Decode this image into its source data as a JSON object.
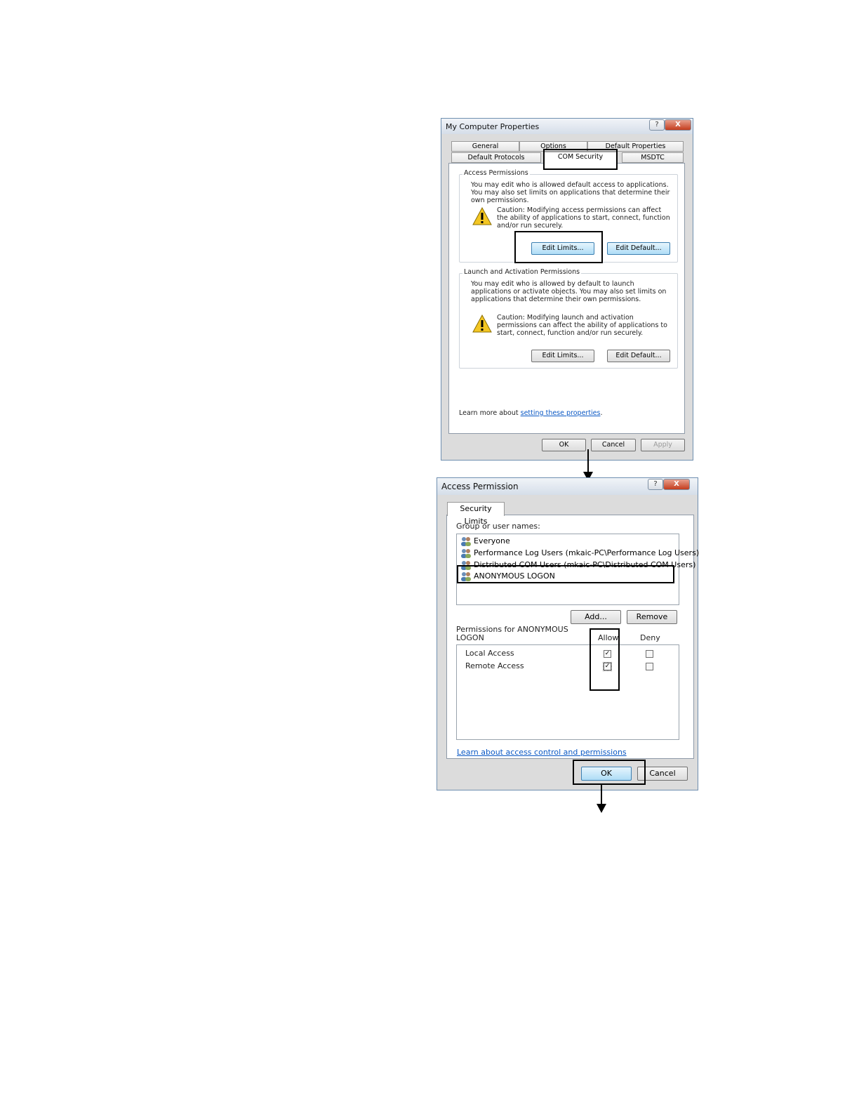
{
  "dialog1": {
    "title": "My Computer Properties",
    "help_label": "?",
    "close_label": "X",
    "tabs_row1": [
      "General",
      "Options",
      "Default Properties"
    ],
    "tabs_row2": [
      "Default Protocols",
      "COM Security",
      "MSDTC"
    ],
    "access": {
      "legend": "Access Permissions",
      "desc": "You may edit who is allowed default access to applications. You may also set limits on applications that determine their own permissions.",
      "caution": "Caution: Modifying access permissions can affect the ability of applications to start, connect, function and/or run securely.",
      "edit_limits": "Edit Limits...",
      "edit_default": "Edit Default..."
    },
    "launch": {
      "legend": "Launch and Activation Permissions",
      "desc": "You may edit who is allowed by default to launch applications or activate objects. You may also set limits on applications that determine their own permissions.",
      "caution": "Caution: Modifying launch and activation permissions can affect the ability of applications to start, connect, function and/or run securely.",
      "edit_limits": "Edit Limits...",
      "edit_default": "Edit Default..."
    },
    "learn_prefix": "Learn more about",
    "learn_link": "setting these properties",
    "learn_suffix": ".",
    "ok": "OK",
    "cancel": "Cancel",
    "apply": "Apply"
  },
  "dialog2": {
    "title": "Access Permission",
    "help_label": "?",
    "close_label": "X",
    "tab": "Security Limits",
    "group_label": "Group or user names:",
    "users": [
      "Everyone",
      "Performance Log Users (mkaic-PC\\Performance Log Users)",
      "Distributed COM Users (mkaic-PC\\Distributed COM Users)",
      "ANONYMOUS LOGON"
    ],
    "add": "Add...",
    "remove": "Remove",
    "perm_label": "Permissions for ANONYMOUS LOGON",
    "allow": "Allow",
    "deny": "Deny",
    "permissions": [
      {
        "name": "Local Access",
        "allow": true,
        "deny": false
      },
      {
        "name": "Remote Access",
        "allow": true,
        "deny": false
      }
    ],
    "learn_link": "Learn about access control and permissions",
    "ok": "OK",
    "cancel": "Cancel"
  }
}
